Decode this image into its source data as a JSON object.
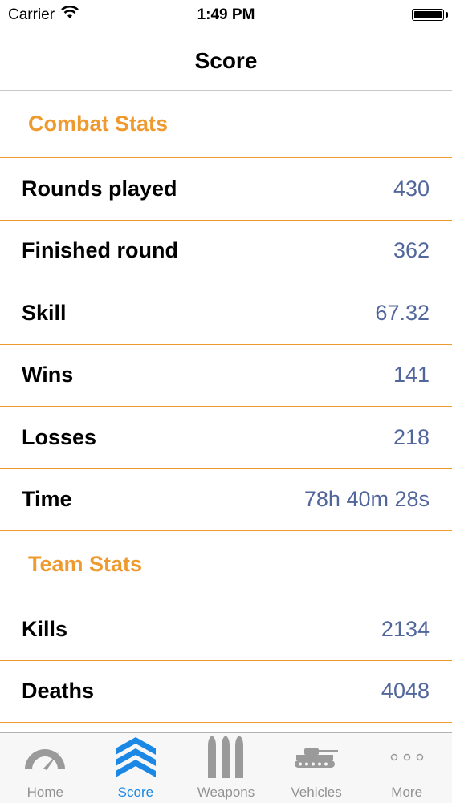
{
  "status_bar": {
    "carrier": "Carrier",
    "time": "1:49 PM"
  },
  "nav": {
    "title": "Score"
  },
  "sections": [
    {
      "title": "Combat Stats",
      "rows": [
        {
          "label": "Rounds played",
          "value": "430"
        },
        {
          "label": "Finished round",
          "value": "362"
        },
        {
          "label": "Skill",
          "value": "67.32"
        },
        {
          "label": "Wins",
          "value": "141"
        },
        {
          "label": "Losses",
          "value": "218"
        },
        {
          "label": "Time",
          "value": "78h 40m 28s"
        }
      ]
    },
    {
      "title": "Team Stats",
      "rows": [
        {
          "label": "Kills",
          "value": "2134"
        },
        {
          "label": "Deaths",
          "value": "4048"
        }
      ]
    }
  ],
  "tab_bar": {
    "tabs": [
      {
        "label": "Home",
        "icon": "speedometer-icon",
        "active": false
      },
      {
        "label": "Score",
        "icon": "chevron-rank-icon",
        "active": true
      },
      {
        "label": "Weapons",
        "icon": "bullets-icon",
        "active": false
      },
      {
        "label": "Vehicles",
        "icon": "tank-icon",
        "active": false
      },
      {
        "label": "More",
        "icon": "more-dots-icon",
        "active": false
      }
    ]
  },
  "colors": {
    "accent": "#ee9a2e",
    "value": "#51669b",
    "tab_active": "#1a88e4",
    "tab_inactive": "#929292"
  }
}
